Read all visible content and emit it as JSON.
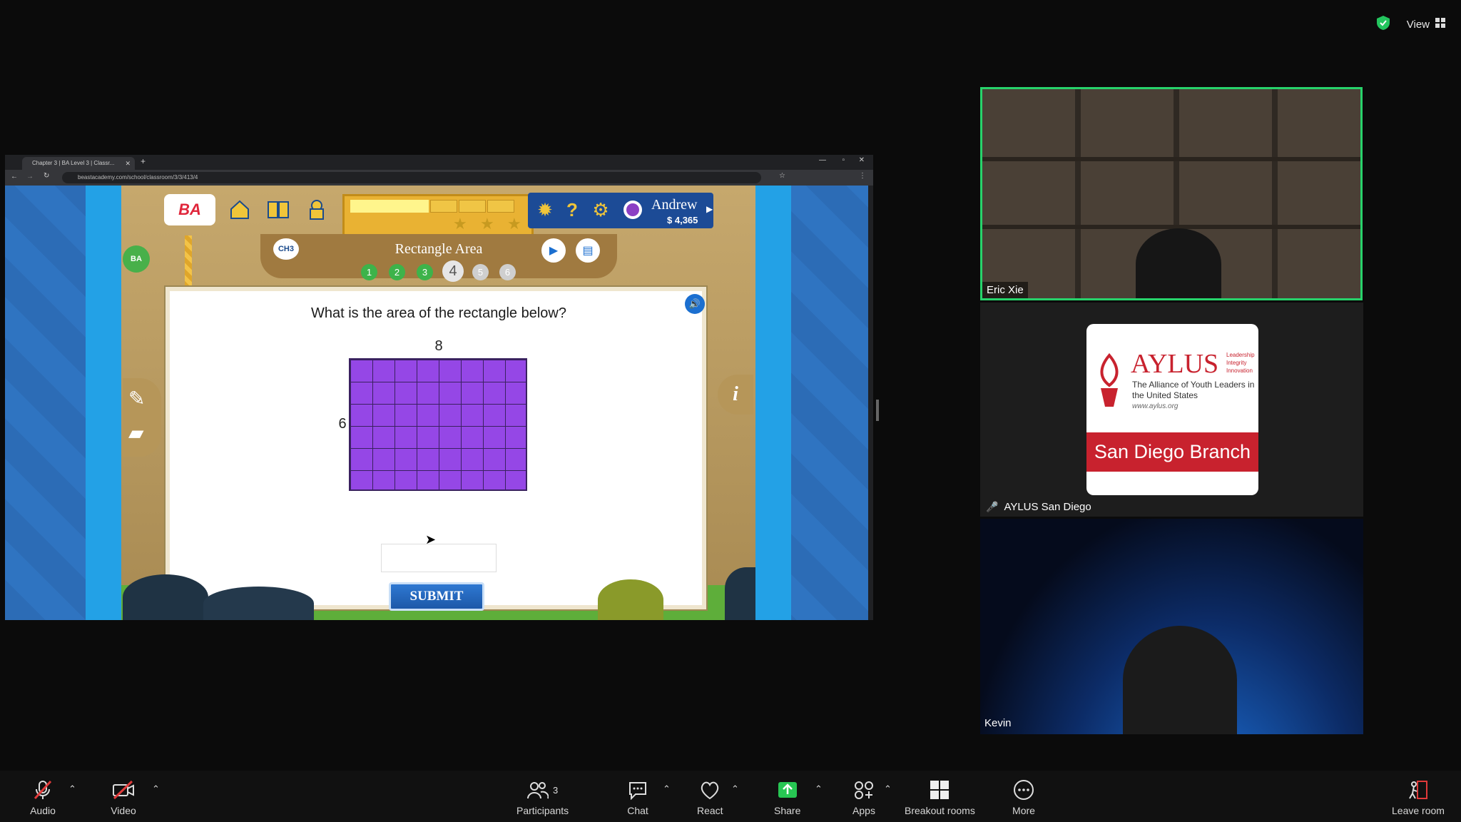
{
  "top_right": {
    "view_label": "View"
  },
  "browser": {
    "tab_title": "Chapter 3 | BA Level 3 | Classr...",
    "url": "beastacademy.com/school/classroom/3/3/413/4"
  },
  "game": {
    "logo_text": "BA",
    "chapter_badge": "CH3",
    "user_name": "Andrew",
    "coins": "4,365",
    "lesson_title": "Rectangle Area",
    "progress_dots": [
      "1",
      "2",
      "3",
      "4",
      "5",
      "6"
    ],
    "question": "What is the area of the rectangle below?",
    "rect_top_label": "8",
    "rect_side_label": "6",
    "submit_label": "SUBMIT",
    "answer_value": ""
  },
  "participants": {
    "tile1_name": "Eric Xie",
    "tile2_name": "AYLUS San Diego",
    "tile3_name": "Kevin",
    "aylus_title": "AYLUS",
    "aylus_tagline_1": "Leadership",
    "aylus_tagline_2": "Integrity",
    "aylus_tagline_3": "Innovation",
    "aylus_sub": "The Alliance of Youth Leaders in the United States",
    "aylus_url": "www.aylus.org",
    "aylus_branch": "San Diego Branch"
  },
  "toolbar": {
    "audio": "Audio",
    "video": "Video",
    "participants": "Participants",
    "participants_count": "3",
    "chat": "Chat",
    "react": "React",
    "share": "Share",
    "apps": "Apps",
    "breakout": "Breakout rooms",
    "more": "More",
    "leave": "Leave room"
  },
  "colors": {
    "accent_green": "#27d36b",
    "share_green": "#27c653",
    "rect_purple": "#9547e6",
    "aylus_red": "#c8222e"
  }
}
